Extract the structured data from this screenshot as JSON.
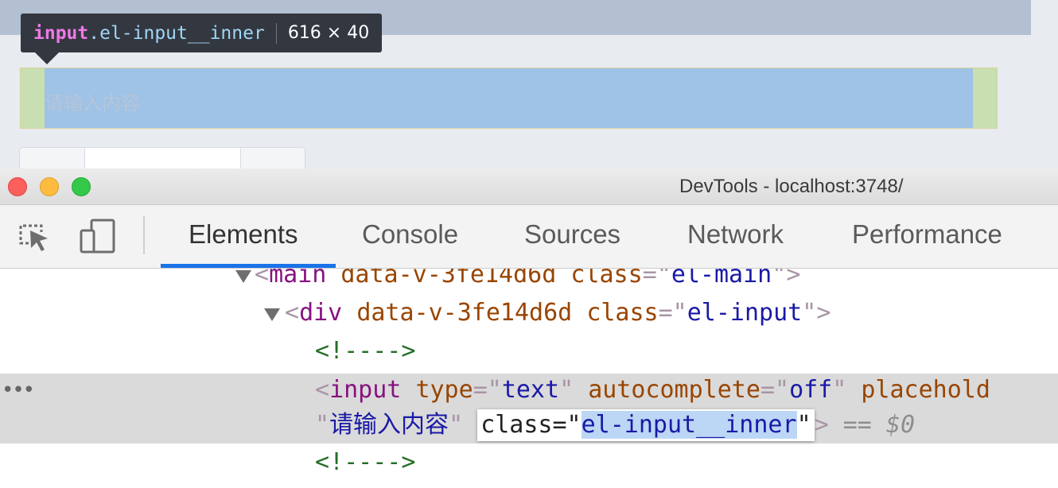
{
  "page": {
    "tooltip": {
      "tag": "input",
      "class": ".el-input__inner",
      "size": "616 × 40"
    },
    "input": {
      "placeholder": "请输入内容"
    }
  },
  "devtools": {
    "window_title": "DevTools - localhost:3748/",
    "toolbar": {
      "icons": [
        "inspect-element-icon",
        "device-toolbar-icon"
      ],
      "tabs": [
        "Elements",
        "Console",
        "Sources",
        "Network",
        "Performance"
      ],
      "active_tab": "Elements",
      "accent_color": "#1a73e8"
    },
    "dom": {
      "main_line": {
        "tag": "main",
        "attr1": "data-v-3fe14d6d",
        "class_attr": "class",
        "class_val": "el-main"
      },
      "div_line": {
        "tag": "div",
        "attr1": "data-v-3fe14d6d",
        "class_attr": "class",
        "class_val": "el-input"
      },
      "comment1": "<!---->",
      "input_line": {
        "tag": "input",
        "type_attr": "type",
        "type_val": "text",
        "autocomplete_attr": "autocomplete",
        "autocomplete_val": "off",
        "placeholder_attr": "placehold",
        "placeholder_val": "请输入内容",
        "edit_class_attr": "class",
        "edit_class_val": "el-input__inner",
        "console_ref": "== $0"
      },
      "comment2": "<!---->",
      "more_actions": "•••"
    }
  }
}
